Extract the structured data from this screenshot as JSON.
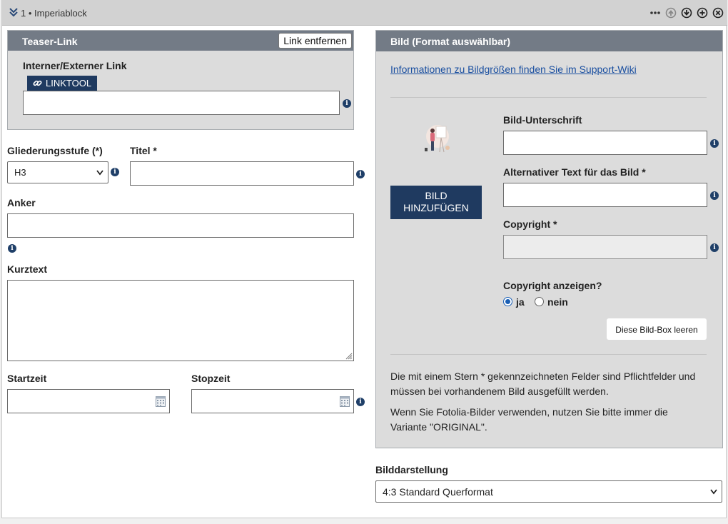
{
  "header": {
    "title": "1 • Imperiablock",
    "icons": [
      "chevron-double-down-icon",
      "more-icon",
      "move-up-icon",
      "move-down-icon",
      "add-icon",
      "close-icon"
    ]
  },
  "teaser": {
    "title": "Teaser-Link",
    "remove_label": "Link entfernen",
    "link_label": "Interner/Externer Link",
    "linktool_label": "LINKTOOL",
    "link_value": ""
  },
  "form": {
    "level_label": "Gliederungsstufe (*)",
    "level_value": "H3",
    "title_label": "Titel *",
    "title_value": "",
    "anchor_label": "Anker",
    "anchor_value": "",
    "short_label": "Kurztext",
    "short_value": "",
    "start_label": "Startzeit",
    "start_value": "",
    "stop_label": "Stopzeit",
    "stop_value": ""
  },
  "image": {
    "title": "Bild (Format auswählbar)",
    "wiki_link": "Informationen zu Bildgrößen finden Sie im Support-Wiki",
    "add_label_1": "BILD",
    "add_label_2": "HINZUFÜGEN",
    "caption_label": "Bild-Unterschrift",
    "alt_label": "Alternativer Text für das Bild *",
    "copyright_label": "Copyright *",
    "show_copyright_label": "Copyright anzeigen?",
    "radio_yes": "ja",
    "radio_no": "nein",
    "radio_selected": "ja",
    "clear_label": "Diese Bild-Box leeren",
    "note1_line1": "Die mit einem Stern * gekennzeichneten Felder sind Pflichtfelder und",
    "note1_line2": "müssen bei vorhandenem Bild ausgefüllt werden.",
    "note2_line1": "Wenn Sie Fotolia-Bilder verwenden, nutzen Sie bitte immer die",
    "note2_line2": "Variante \"ORIGINAL\"."
  },
  "display": {
    "label": "Bilddarstellung",
    "value": "4:3 Standard Querformat"
  },
  "colors": {
    "panel_header": "#737b86",
    "panel_bg": "#dcdcdc",
    "primary_button": "#1f3a60",
    "link": "#1a4fa0",
    "radio_accent": "#1a5fb4"
  }
}
